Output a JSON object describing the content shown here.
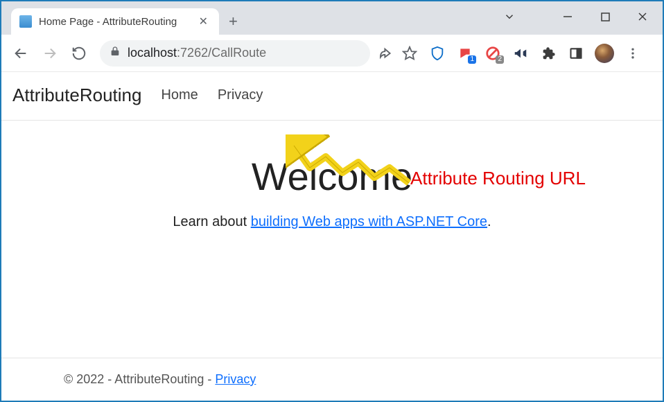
{
  "window": {
    "tab_title": "Home Page - AttributeRouting",
    "minimize": "—",
    "maximize": "□",
    "close": "✕",
    "dropdown": "⌄"
  },
  "toolbar": {
    "url_host": "localhost",
    "url_rest": ":7262/CallRoute"
  },
  "extensions": {
    "badge1": "1",
    "badge2": "2"
  },
  "page": {
    "brand": "AttributeRouting",
    "nav": {
      "home": "Home",
      "privacy": "Privacy"
    },
    "hero_title": "Welcome",
    "hero_lead_prefix": "Learn about ",
    "hero_link": "building Web apps with ASP.NET Core",
    "hero_lead_suffix": "."
  },
  "footer": {
    "text": "© 2022 - AttributeRouting - ",
    "privacy": "Privacy"
  },
  "annotation": {
    "label": "Attribute Routing URL"
  }
}
